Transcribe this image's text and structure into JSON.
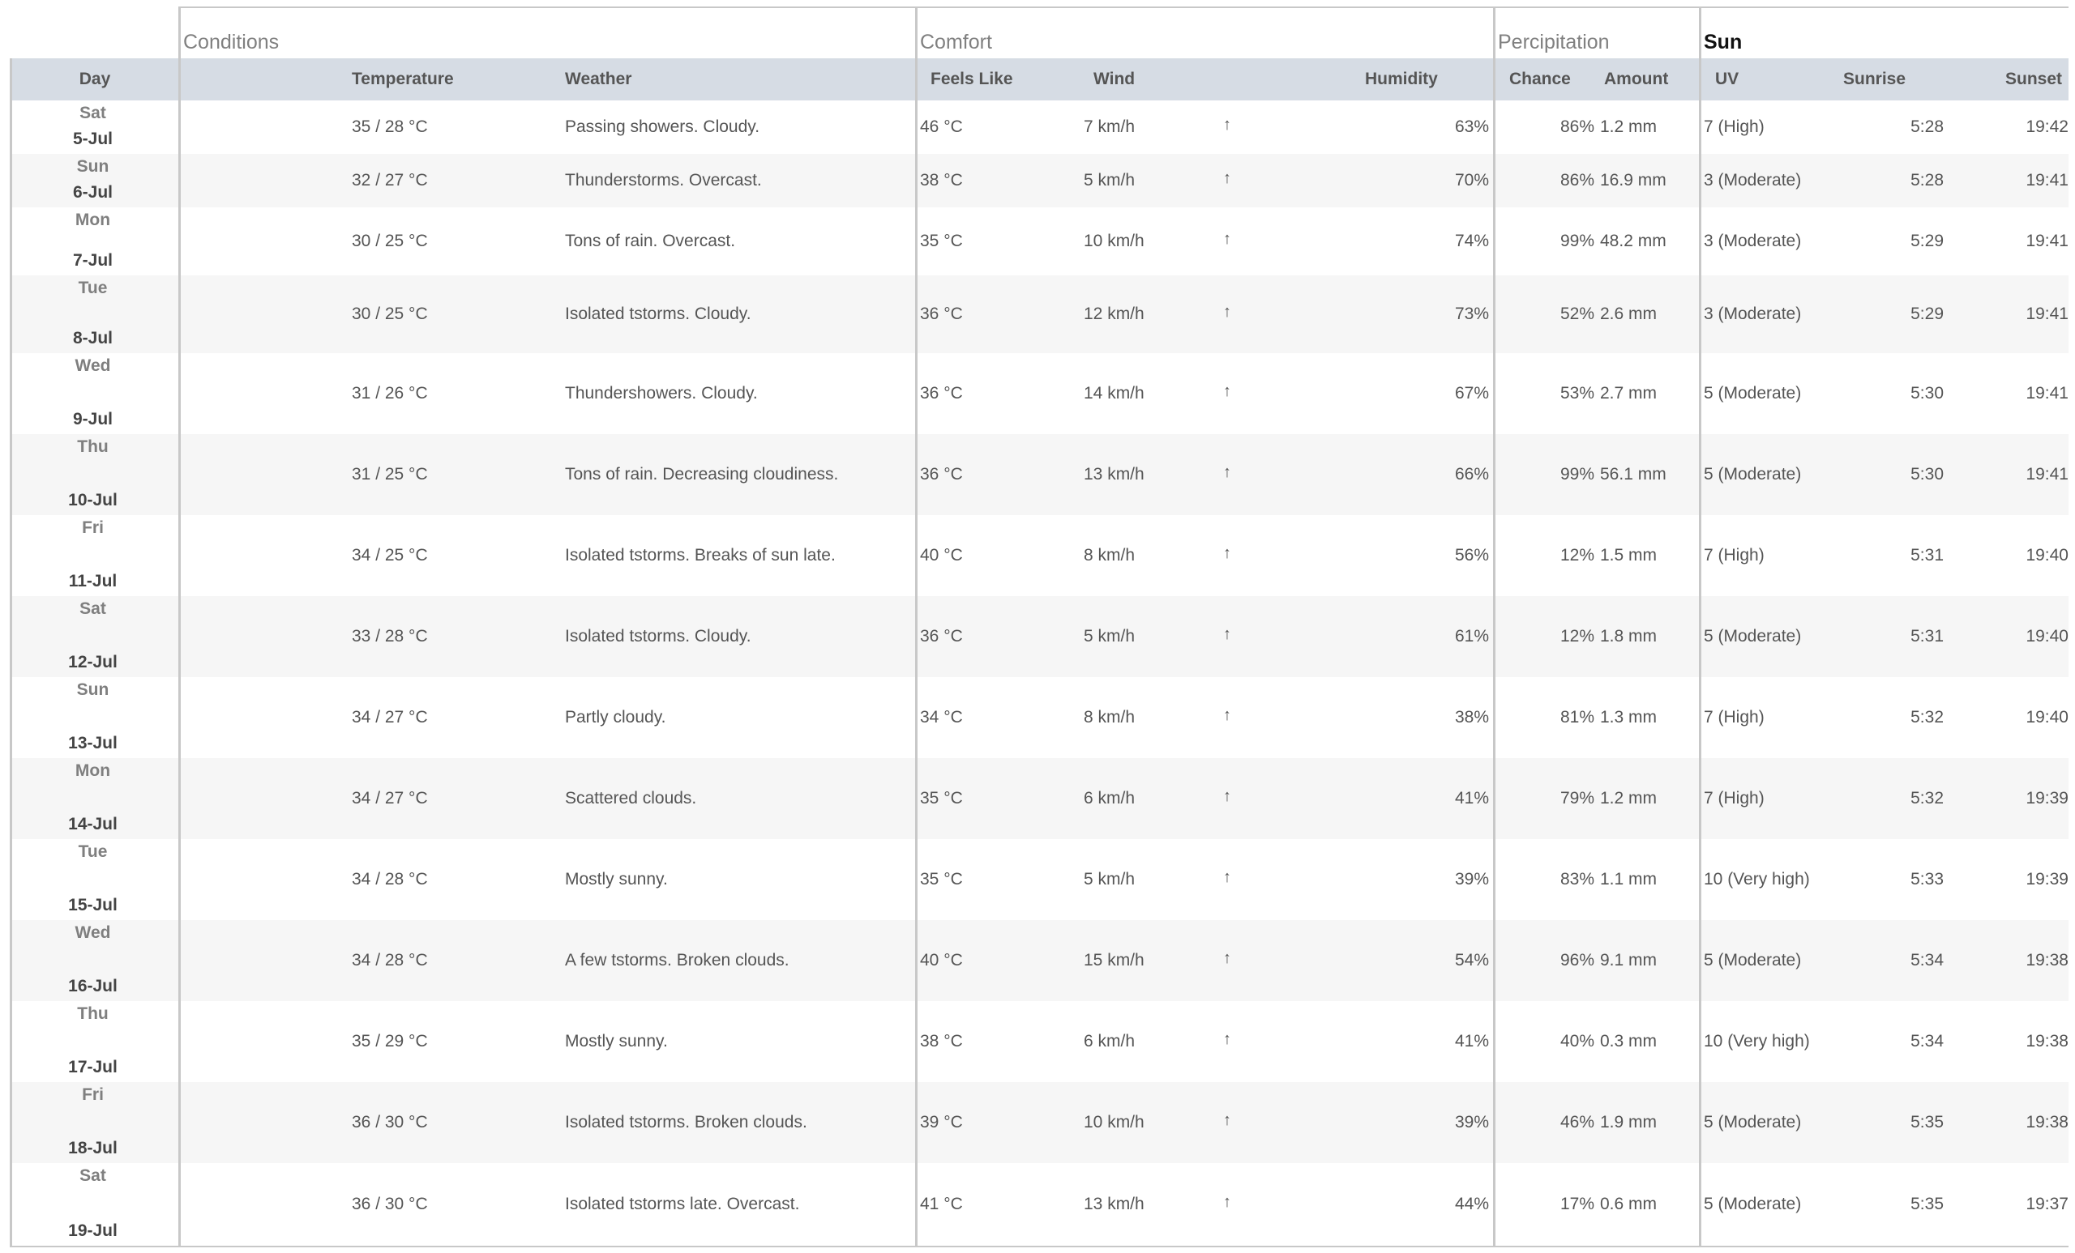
{
  "groups": {
    "conditions": "Conditions",
    "comfort": "Comfort",
    "precipitation": "Percipitation",
    "sun": "Sun"
  },
  "headers": {
    "day": "Day",
    "temperature": "Temperature",
    "weather": "Weather",
    "feels_like": "Feels Like",
    "wind": "Wind",
    "humidity": "Humidity",
    "chance": "Chance",
    "amount": "Amount",
    "uv": "UV",
    "sunrise": "Sunrise",
    "sunset": "Sunset"
  },
  "wind_direction_icon": "arrow-up-icon",
  "rows": [
    {
      "dow": "Sat",
      "date": "5-Jul",
      "temp": "35 / 28 °C",
      "weather": "Passing showers. Cloudy.",
      "feels": "46 °C",
      "wind": "7 km/h",
      "humidity": "63%",
      "chance": "86%",
      "amount": "1.2 mm",
      "uv": "7 (High)",
      "sunrise": "5:28",
      "sunset": "19:42"
    },
    {
      "dow": "Sun",
      "date": "6-Jul",
      "temp": "32 / 27 °C",
      "weather": "Thunderstorms. Overcast.",
      "feels": "38 °C",
      "wind": "5 km/h",
      "humidity": "70%",
      "chance": "86%",
      "amount": "16.9 mm",
      "uv": "3 (Moderate)",
      "sunrise": "5:28",
      "sunset": "19:41"
    },
    {
      "dow": "Mon",
      "date": "7-Jul",
      "temp": "30 / 25 °C",
      "weather": "Tons of rain. Overcast.",
      "feels": "35 °C",
      "wind": "10 km/h",
      "humidity": "74%",
      "chance": "99%",
      "amount": "48.2 mm",
      "uv": "3 (Moderate)",
      "sunrise": "5:29",
      "sunset": "19:41"
    },
    {
      "dow": "Tue",
      "date": "8-Jul",
      "temp": "30 / 25 °C",
      "weather": "Isolated tstorms. Cloudy.",
      "feels": "36 °C",
      "wind": "12 km/h",
      "humidity": "73%",
      "chance": "52%",
      "amount": "2.6 mm",
      "uv": "3 (Moderate)",
      "sunrise": "5:29",
      "sunset": "19:41"
    },
    {
      "dow": "Wed",
      "date": "9-Jul",
      "temp": "31 / 26 °C",
      "weather": "Thundershowers. Cloudy.",
      "feels": "36 °C",
      "wind": "14 km/h",
      "humidity": "67%",
      "chance": "53%",
      "amount": "2.7 mm",
      "uv": "5 (Moderate)",
      "sunrise": "5:30",
      "sunset": "19:41"
    },
    {
      "dow": "Thu",
      "date": "10-Jul",
      "temp": "31 / 25 °C",
      "weather": "Tons of rain. Decreasing cloudiness.",
      "feels": "36 °C",
      "wind": "13 km/h",
      "humidity": "66%",
      "chance": "99%",
      "amount": "56.1 mm",
      "uv": "5 (Moderate)",
      "sunrise": "5:30",
      "sunset": "19:41"
    },
    {
      "dow": "Fri",
      "date": "11-Jul",
      "temp": "34 / 25 °C",
      "weather": "Isolated tstorms. Breaks of sun late.",
      "feels": "40 °C",
      "wind": "8 km/h",
      "humidity": "56%",
      "chance": "12%",
      "amount": "1.5 mm",
      "uv": "7 (High)",
      "sunrise": "5:31",
      "sunset": "19:40"
    },
    {
      "dow": "Sat",
      "date": "12-Jul",
      "temp": "33 / 28 °C",
      "weather": "Isolated tstorms. Cloudy.",
      "feels": "36 °C",
      "wind": "5 km/h",
      "humidity": "61%",
      "chance": "12%",
      "amount": "1.8 mm",
      "uv": "5 (Moderate)",
      "sunrise": "5:31",
      "sunset": "19:40"
    },
    {
      "dow": "Sun",
      "date": "13-Jul",
      "temp": "34 / 27 °C",
      "weather": "Partly cloudy.",
      "feels": "34 °C",
      "wind": "8 km/h",
      "humidity": "38%",
      "chance": "81%",
      "amount": "1.3 mm",
      "uv": "7 (High)",
      "sunrise": "5:32",
      "sunset": "19:40"
    },
    {
      "dow": "Mon",
      "date": "14-Jul",
      "temp": "34 / 27 °C",
      "weather": "Scattered clouds.",
      "feels": "35 °C",
      "wind": "6 km/h",
      "humidity": "41%",
      "chance": "79%",
      "amount": "1.2 mm",
      "uv": "7 (High)",
      "sunrise": "5:32",
      "sunset": "19:39"
    },
    {
      "dow": "Tue",
      "date": "15-Jul",
      "temp": "34 / 28 °C",
      "weather": "Mostly sunny.",
      "feels": "35 °C",
      "wind": "5 km/h",
      "humidity": "39%",
      "chance": "83%",
      "amount": "1.1 mm",
      "uv": "10 (Very high)",
      "sunrise": "5:33",
      "sunset": "19:39"
    },
    {
      "dow": "Wed",
      "date": "16-Jul",
      "temp": "34 / 28 °C",
      "weather": "A few tstorms. Broken clouds.",
      "feels": "40 °C",
      "wind": "15 km/h",
      "humidity": "54%",
      "chance": "96%",
      "amount": "9.1 mm",
      "uv": "5 (Moderate)",
      "sunrise": "5:34",
      "sunset": "19:38"
    },
    {
      "dow": "Thu",
      "date": "17-Jul",
      "temp": "35 / 29 °C",
      "weather": "Mostly sunny.",
      "feels": "38 °C",
      "wind": "6 km/h",
      "humidity": "41%",
      "chance": "40%",
      "amount": "0.3 mm",
      "uv": "10 (Very high)",
      "sunrise": "5:34",
      "sunset": "19:38"
    },
    {
      "dow": "Fri",
      "date": "18-Jul",
      "temp": "36 / 30 °C",
      "weather": "Isolated tstorms. Broken clouds.",
      "feels": "39 °C",
      "wind": "10 km/h",
      "humidity": "39%",
      "chance": "46%",
      "amount": "1.9 mm",
      "uv": "5 (Moderate)",
      "sunrise": "5:35",
      "sunset": "19:38"
    },
    {
      "dow": "Sat",
      "date": "19-Jul",
      "temp": "36 / 30 °C",
      "weather": "Isolated tstorms late. Overcast.",
      "feels": "41 °C",
      "wind": "13 km/h",
      "humidity": "44%",
      "chance": "17%",
      "amount": "0.6 mm",
      "uv": "5 (Moderate)",
      "sunrise": "5:35",
      "sunset": "19:37"
    }
  ]
}
